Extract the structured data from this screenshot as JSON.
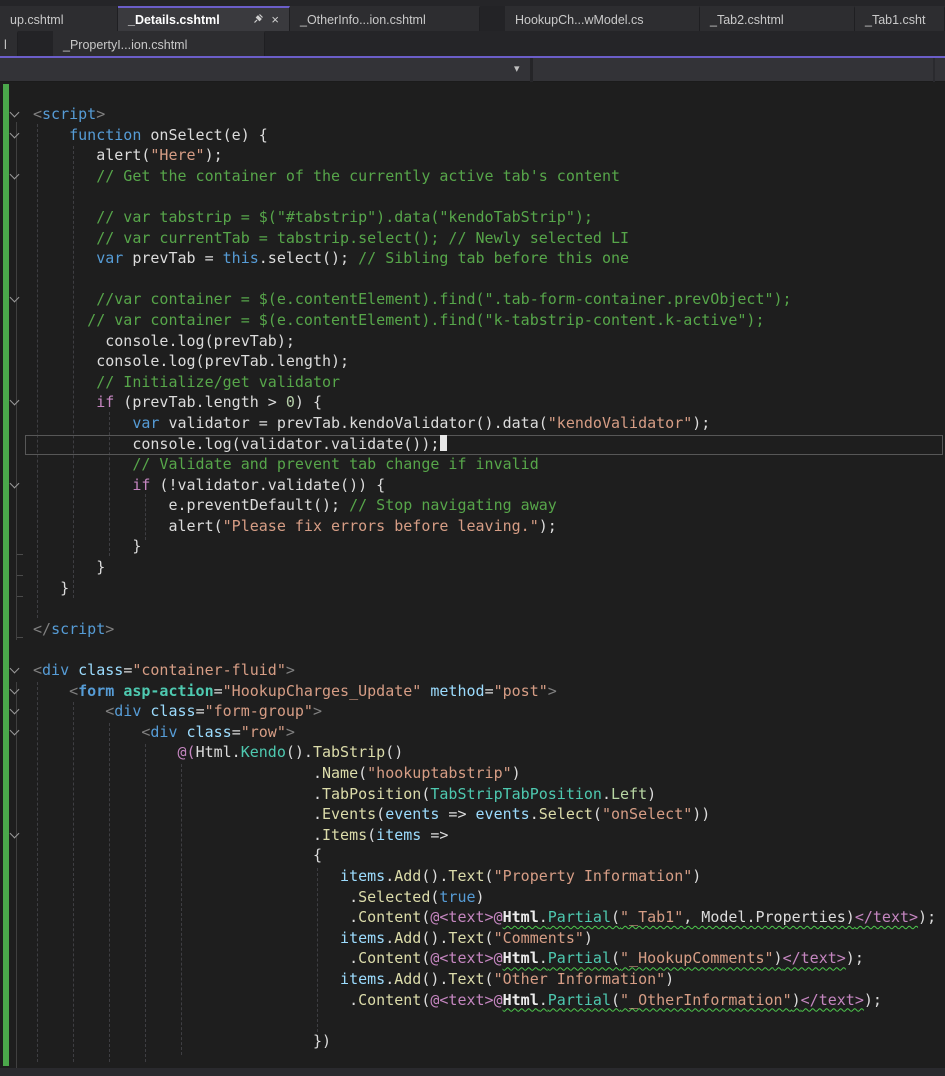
{
  "tabs": {
    "row1": [
      {
        "label": "up.cshtml"
      },
      {
        "label": "_Details.cshtml",
        "active": true
      },
      {
        "label": "_OtherInfo...ion.cshtml"
      },
      {
        "label": "HookupCh...wModel.cs"
      },
      {
        "label": "_Tab2.cshtml"
      },
      {
        "label": "_Tab1.csht"
      }
    ],
    "row2": [
      {
        "label": "l"
      },
      {
        "label": "_PropertyI...ion.cshtml"
      }
    ]
  },
  "icons": {
    "dropdown_arrow": "▾",
    "close_tab": "×"
  },
  "colors": {
    "accent": "#6B5EC9",
    "change_bar_green": "#4BA74B",
    "editor_bg": "#1E1E1E",
    "squiggle_green": "#4EC94E",
    "comment": "#57A64A",
    "string": "#D69D85",
    "keyword": "#569CD6",
    "method": "#DCDCAA",
    "type": "#4EC9B0"
  },
  "editor": {
    "lines": [
      {
        "fold": true,
        "t": [
          [
            "g",
            "<"
          ],
          [
            "k",
            "script"
          ],
          [
            "g",
            ">"
          ]
        ]
      },
      {
        "fold": true,
        "t": [
          [
            "p",
            "    "
          ],
          [
            "k",
            "function"
          ],
          [
            "p",
            " onSelect(e) {"
          ]
        ]
      },
      {
        "t": [
          [
            "p",
            "       alert("
          ],
          [
            "s",
            "\"Here\""
          ],
          [
            "p",
            ");"
          ]
        ]
      },
      {
        "fold": true,
        "t": [
          [
            "c",
            "       // Get the container of the currently active tab's content"
          ]
        ]
      },
      {
        "t": []
      },
      {
        "t": [
          [
            "c",
            "       // var tabstrip = $(\"#tabstrip\").data(\"kendoTabStrip\");"
          ]
        ]
      },
      {
        "t": [
          [
            "c",
            "       // var currentTab = tabstrip.select(); // Newly selected LI"
          ]
        ]
      },
      {
        "t": [
          [
            "p",
            "       "
          ],
          [
            "k",
            "var"
          ],
          [
            "p",
            " prevTab = "
          ],
          [
            "k",
            "this"
          ],
          [
            "p",
            ".select(); "
          ],
          [
            "c",
            "// Sibling tab before this one"
          ]
        ]
      },
      {
        "t": []
      },
      {
        "fold": true,
        "t": [
          [
            "c",
            "       //var container = $(e.contentElement).find(\".tab-form-container.prevObject\");"
          ]
        ]
      },
      {
        "t": [
          [
            "c",
            "      // var container = $(e.contentElement).find(\"k-tabstrip-content.k-active\");"
          ]
        ]
      },
      {
        "t": [
          [
            "p",
            "        console.log(prevTab);"
          ]
        ]
      },
      {
        "t": [
          [
            "p",
            "       console.log(prevTab.length);"
          ]
        ]
      },
      {
        "t": [
          [
            "c",
            "       // Initialize/get validator"
          ]
        ]
      },
      {
        "fold": true,
        "t": [
          [
            "p",
            "       "
          ],
          [
            "r",
            "if"
          ],
          [
            "p",
            " (prevTab.length > "
          ],
          [
            "n",
            "0"
          ],
          [
            "p",
            ") {"
          ]
        ]
      },
      {
        "t": [
          [
            "p",
            "           "
          ],
          [
            "k",
            "var"
          ],
          [
            "p",
            " validator = prevTab.kendoValidator().data("
          ],
          [
            "s",
            "\"kendoValidator\""
          ],
          [
            "p",
            ");"
          ]
        ]
      },
      {
        "caret": true,
        "t": [
          [
            "p",
            "           console.log(validator.validate());"
          ]
        ]
      },
      {
        "t": [
          [
            "c",
            "           // Validate and prevent tab change if invalid"
          ]
        ]
      },
      {
        "fold": true,
        "t": [
          [
            "p",
            "           "
          ],
          [
            "r",
            "if"
          ],
          [
            "p",
            " (!validator.validate()) {"
          ]
        ]
      },
      {
        "t": [
          [
            "p",
            "               e.preventDefault(); "
          ],
          [
            "c",
            "// Stop navigating away"
          ]
        ]
      },
      {
        "t": [
          [
            "p",
            "               alert("
          ],
          [
            "s",
            "\"Please fix errors before leaving.\""
          ],
          [
            "p",
            ");"
          ]
        ]
      },
      {
        "t": [
          [
            "p",
            "           }"
          ]
        ]
      },
      {
        "t": [
          [
            "p",
            "       }"
          ]
        ]
      },
      {
        "t": [
          [
            "p",
            "   }"
          ]
        ]
      },
      {
        "t": []
      },
      {
        "t": [
          [
            "g",
            "</"
          ],
          [
            "k",
            "script"
          ],
          [
            "g",
            ">"
          ]
        ]
      },
      {
        "t": []
      },
      {
        "fold": true,
        "t": [
          [
            "g",
            "<"
          ],
          [
            "k",
            "div"
          ],
          [
            "p",
            " "
          ],
          [
            "v",
            "class"
          ],
          [
            "p",
            "="
          ],
          [
            "s",
            "\"container-fluid\""
          ],
          [
            "g",
            ">"
          ]
        ]
      },
      {
        "fold": true,
        "t": [
          [
            "p",
            "    "
          ],
          [
            "g",
            "<"
          ],
          [
            "k bold",
            "form"
          ],
          [
            "p",
            " "
          ],
          [
            "t bold",
            "asp-action"
          ],
          [
            "p",
            "="
          ],
          [
            "s",
            "\"HookupCharges_Update\""
          ],
          [
            "p",
            " "
          ],
          [
            "v",
            "method"
          ],
          [
            "p",
            "="
          ],
          [
            "s",
            "\"post\""
          ],
          [
            "g",
            ">"
          ]
        ]
      },
      {
        "fold": true,
        "t": [
          [
            "p",
            "        "
          ],
          [
            "g",
            "<"
          ],
          [
            "k",
            "div"
          ],
          [
            "p",
            " "
          ],
          [
            "v",
            "class"
          ],
          [
            "p",
            "="
          ],
          [
            "s",
            "\"form-group\""
          ],
          [
            "g",
            ">"
          ]
        ]
      },
      {
        "fold": true,
        "t": [
          [
            "p",
            "            "
          ],
          [
            "g",
            "<"
          ],
          [
            "k",
            "div"
          ],
          [
            "p",
            " "
          ],
          [
            "v",
            "class"
          ],
          [
            "p",
            "="
          ],
          [
            "s",
            "\"row\""
          ],
          [
            "g",
            ">"
          ]
        ]
      },
      {
        "t": [
          [
            "p",
            "                "
          ],
          [
            "r",
            "@("
          ],
          [
            "p",
            "Html."
          ],
          [
            "t",
            "Kendo"
          ],
          [
            "p",
            "()."
          ],
          [
            "m",
            "TabStrip"
          ],
          [
            "p",
            "()"
          ]
        ]
      },
      {
        "t": [
          [
            "p",
            "                               ."
          ],
          [
            "m",
            "Name"
          ],
          [
            "p",
            "("
          ],
          [
            "s",
            "\"hookuptabstrip\""
          ],
          [
            "p",
            ")"
          ]
        ]
      },
      {
        "t": [
          [
            "p",
            "                               ."
          ],
          [
            "m",
            "TabPosition"
          ],
          [
            "p",
            "("
          ],
          [
            "t",
            "TabStripTabPosition"
          ],
          [
            "p",
            "."
          ],
          [
            "en",
            "Left"
          ],
          [
            "p",
            ")"
          ]
        ]
      },
      {
        "t": [
          [
            "p",
            "                               ."
          ],
          [
            "m",
            "Events"
          ],
          [
            "p",
            "("
          ],
          [
            "v",
            "events"
          ],
          [
            "p",
            " => "
          ],
          [
            "v",
            "events"
          ],
          [
            "p",
            "."
          ],
          [
            "m",
            "Select"
          ],
          [
            "p",
            "("
          ],
          [
            "s",
            "\"onSelect\""
          ],
          [
            "p",
            "))"
          ]
        ]
      },
      {
        "fold": true,
        "t": [
          [
            "p",
            "                               ."
          ],
          [
            "m",
            "Items"
          ],
          [
            "p",
            "("
          ],
          [
            "v",
            "items"
          ],
          [
            "p",
            " =>"
          ]
        ]
      },
      {
        "t": [
          [
            "p",
            "                               {"
          ]
        ]
      },
      {
        "t": [
          [
            "p",
            "                                  "
          ],
          [
            "v",
            "items"
          ],
          [
            "p",
            "."
          ],
          [
            "m",
            "Add"
          ],
          [
            "p",
            "()."
          ],
          [
            "m",
            "Text"
          ],
          [
            "p",
            "("
          ],
          [
            "s",
            "\"Property Information\""
          ],
          [
            "p",
            ")"
          ]
        ]
      },
      {
        "t": [
          [
            "p",
            "                                   ."
          ],
          [
            "m",
            "Selected"
          ],
          [
            "p",
            "("
          ],
          [
            "k",
            "true"
          ],
          [
            "p",
            ")"
          ]
        ]
      },
      {
        "t": [
          [
            "p",
            "                                   ."
          ],
          [
            "m",
            "Content"
          ],
          [
            "p",
            "("
          ],
          [
            "r",
            "@<text>"
          ],
          [
            "r",
            "@"
          ],
          [
            "hb wav",
            "Html"
          ],
          [
            "p wav",
            "."
          ],
          [
            "t wav",
            "Partial"
          ],
          [
            "p wav",
            "("
          ],
          [
            "s wav",
            "\"_Tab1\""
          ],
          [
            "p wav",
            ", Model.Properties)"
          ],
          [
            "r wav",
            "</text>"
          ],
          [
            "p",
            ");"
          ]
        ]
      },
      {
        "t": [
          [
            "p",
            "                                  "
          ],
          [
            "v",
            "items"
          ],
          [
            "p",
            "."
          ],
          [
            "m",
            "Add"
          ],
          [
            "p",
            "()."
          ],
          [
            "m",
            "Text"
          ],
          [
            "p",
            "("
          ],
          [
            "s",
            "\"Comments\""
          ],
          [
            "p",
            ")"
          ]
        ]
      },
      {
        "t": [
          [
            "p",
            "                                   ."
          ],
          [
            "m",
            "Content"
          ],
          [
            "p",
            "("
          ],
          [
            "r",
            "@<text>"
          ],
          [
            "r",
            "@"
          ],
          [
            "hb wav",
            "Html"
          ],
          [
            "p wav",
            "."
          ],
          [
            "t wav",
            "Partial"
          ],
          [
            "p wav",
            "("
          ],
          [
            "s wav",
            "\"_HookupComments\""
          ],
          [
            "p wav",
            ")"
          ],
          [
            "r wav",
            "</text>"
          ],
          [
            "p",
            ");"
          ]
        ]
      },
      {
        "t": [
          [
            "p",
            "                                  "
          ],
          [
            "v",
            "items"
          ],
          [
            "p",
            "."
          ],
          [
            "m",
            "Add"
          ],
          [
            "p",
            "()."
          ],
          [
            "m",
            "Text"
          ],
          [
            "p",
            "("
          ],
          [
            "s",
            "\"Other Information\""
          ],
          [
            "p",
            ")"
          ]
        ]
      },
      {
        "t": [
          [
            "p",
            "                                   ."
          ],
          [
            "m",
            "Content"
          ],
          [
            "p",
            "("
          ],
          [
            "r",
            "@<text>"
          ],
          [
            "r",
            "@"
          ],
          [
            "hb wav",
            "Html"
          ],
          [
            "p wav",
            "."
          ],
          [
            "t wav",
            "Partial"
          ],
          [
            "p wav",
            "("
          ],
          [
            "s wav",
            "\"_OtherInformation\""
          ],
          [
            "p wav",
            ")"
          ],
          [
            "r wav",
            "</text>"
          ],
          [
            "p",
            ");"
          ]
        ]
      },
      {
        "t": []
      },
      {
        "t": [
          [
            "p",
            "                               })"
          ]
        ]
      }
    ]
  }
}
